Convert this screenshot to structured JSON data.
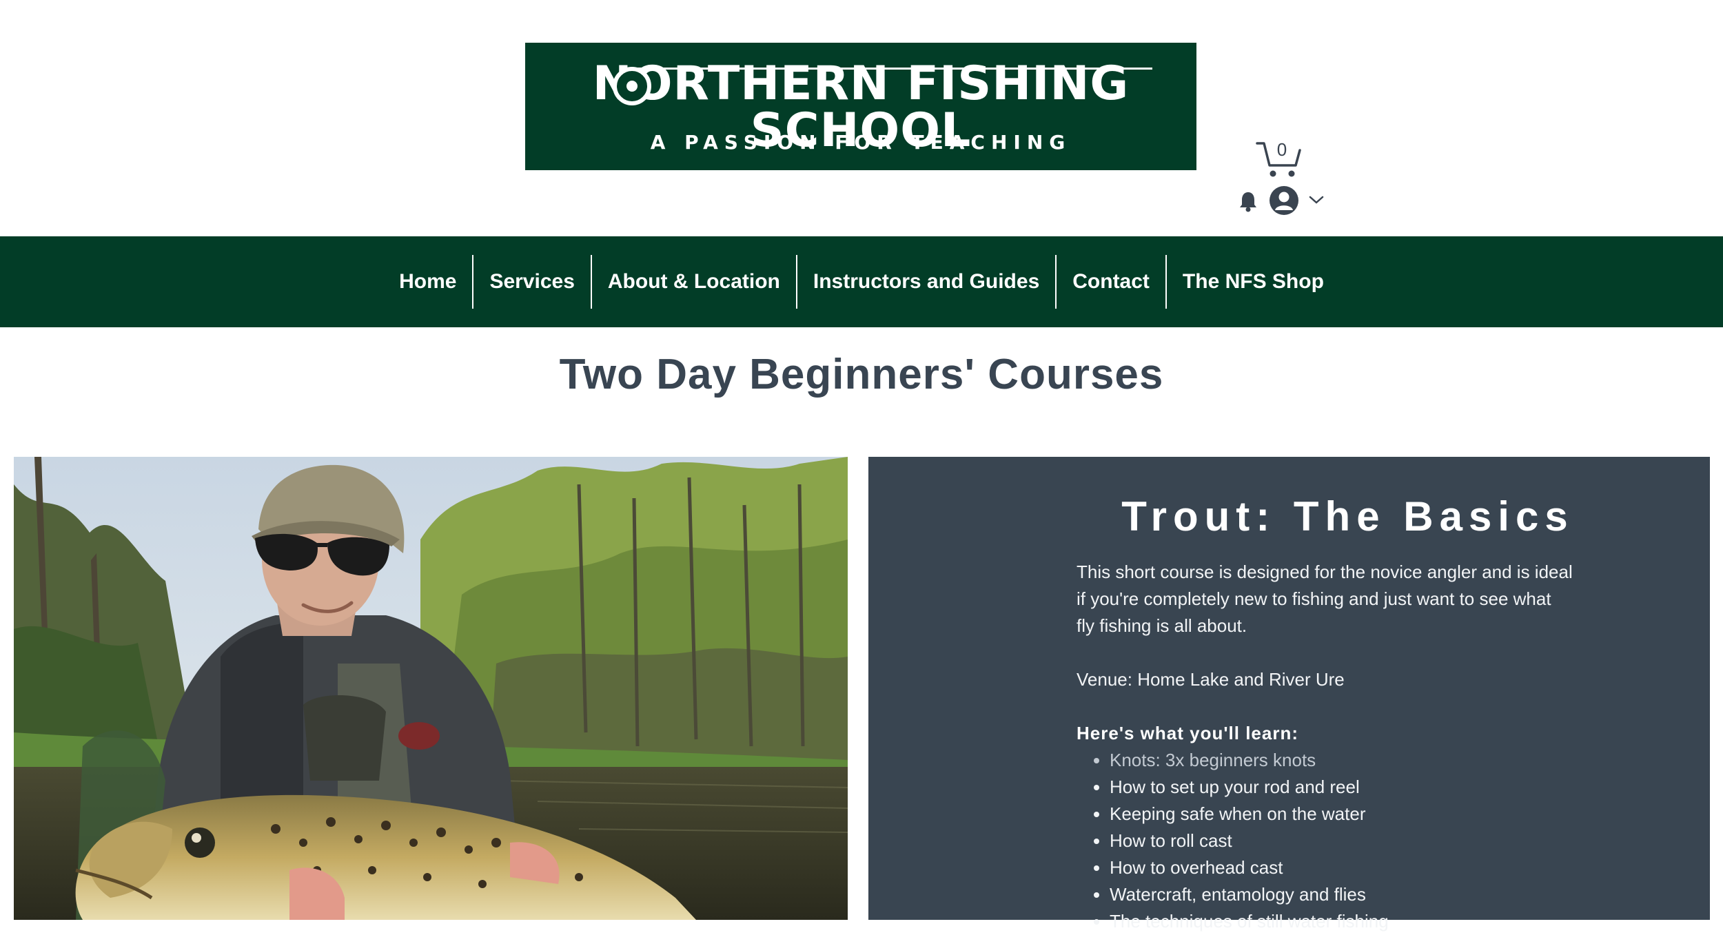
{
  "header": {
    "logo": {
      "title": "NORTHERN FISHING SCHOOL",
      "tagline": "A PASSION FOR TEACHING"
    },
    "cart": {
      "count": "0",
      "icon": "cart-icon"
    },
    "notifications_icon": "bell-icon",
    "account_icon": "user-avatar-icon",
    "account_menu_icon": "chevron-down-icon"
  },
  "nav": {
    "items": [
      {
        "label": "Home"
      },
      {
        "label": "Services"
      },
      {
        "label": "About & Location"
      },
      {
        "label": "Instructors and Guides"
      },
      {
        "label": "Contact"
      },
      {
        "label": "The NFS Shop"
      }
    ]
  },
  "page": {
    "title": "Two Day Beginners' Courses"
  },
  "course": {
    "title": "Trout: The Basics",
    "description": "This short course is designed for the novice angler and is ideal if you're completely new to fishing and just want to see what fly fishing is all about.",
    "venue": "Venue: Home Lake and River Ure",
    "learn_heading": "Here's what you'll learn:",
    "learn_items": [
      "Knots: 3x beginners knots",
      "How to set up your rod and reel",
      "Keeping safe when on the water",
      "How to roll cast",
      "How to overhead cast",
      "Watercraft, entamology and flies",
      "The techniques of still water fishing"
    ]
  },
  "colors": {
    "brand_green": "#023d27",
    "panel_slate": "#394551",
    "title_text": "#394552"
  }
}
